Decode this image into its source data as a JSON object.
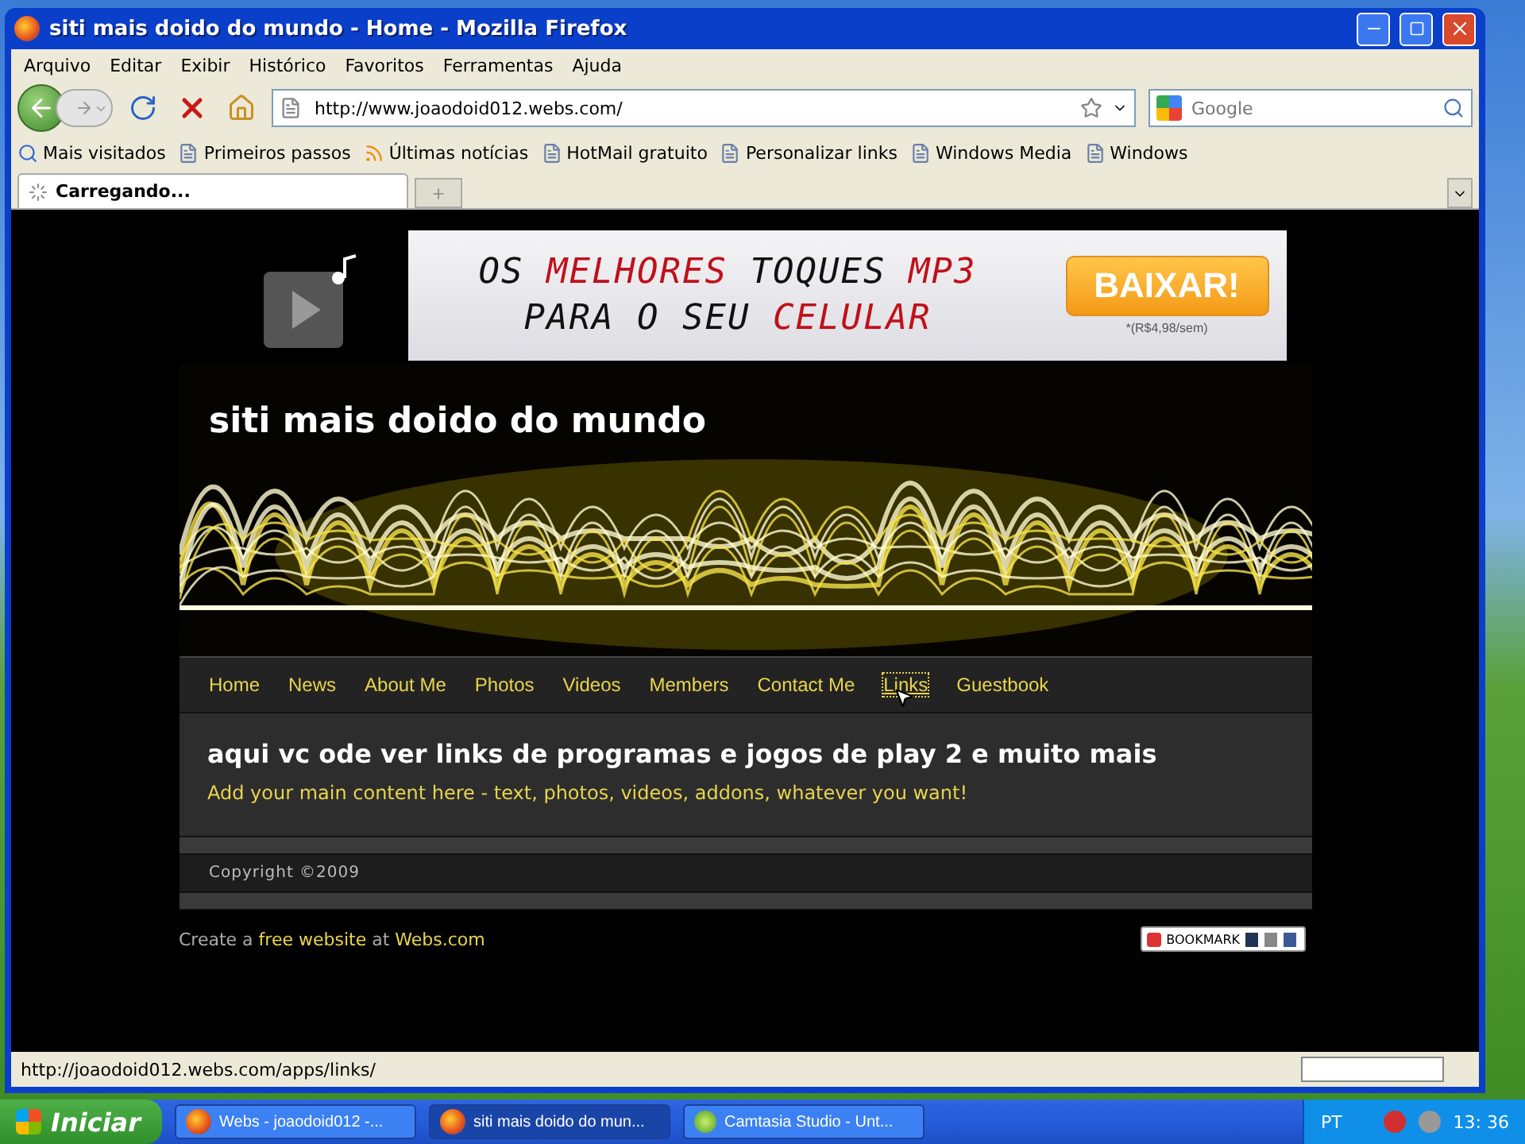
{
  "window": {
    "title": "siti mais doido do mundo - Home - Mozilla Firefox"
  },
  "menu": [
    "Arquivo",
    "Editar",
    "Exibir",
    "Histórico",
    "Favoritos",
    "Ferramentas",
    "Ajuda"
  ],
  "address": {
    "value": "http://www.joaodoid012.webs.com/"
  },
  "search": {
    "placeholder": "Google"
  },
  "bookmarks": [
    {
      "label": "Mais visitados",
      "kind": "folder"
    },
    {
      "label": "Primeiros passos",
      "kind": "page"
    },
    {
      "label": "Últimas notícias",
      "kind": "feed"
    },
    {
      "label": "HotMail gratuito",
      "kind": "page"
    },
    {
      "label": "Personalizar links",
      "kind": "page"
    },
    {
      "label": "Windows Media",
      "kind": "page"
    },
    {
      "label": "Windows",
      "kind": "page"
    }
  ],
  "tabs": [
    {
      "label": "Carregando...",
      "selected": true
    }
  ],
  "ad": {
    "line_1": [
      {
        "text": "OS ",
        "color": "#111111"
      },
      {
        "text": "MELHORES ",
        "color": "#c0101a"
      },
      {
        "text": "TOQUES ",
        "color": "#111111"
      },
      {
        "text": "MP3",
        "color": "#c0101a"
      }
    ],
    "line_2": [
      {
        "text": "PARA O SEU ",
        "color": "#111111"
      },
      {
        "text": "CELULAR",
        "color": "#c0101a"
      }
    ],
    "button": "BAIXAR!",
    "price": "*(R$4,98/sem)"
  },
  "site": {
    "title": "siti mais doido do mundo",
    "nav": [
      {
        "label": "Home",
        "selected": false
      },
      {
        "label": "News",
        "selected": false
      },
      {
        "label": "About Me",
        "selected": false
      },
      {
        "label": "Photos",
        "selected": false
      },
      {
        "label": "Videos",
        "selected": false
      },
      {
        "label": "Members",
        "selected": false
      },
      {
        "label": "Contact Me",
        "selected": false
      },
      {
        "label": "Links",
        "selected": true
      },
      {
        "label": "Guestbook",
        "selected": false
      }
    ],
    "heading": "aqui vc ode ver links de programas e jogos de play 2 e muito mais",
    "body": "Add your main content here - text, photos, videos, addons, whatever you want!",
    "copyright": "Copyright ©2009",
    "footer": [
      {
        "text": "Create a ",
        "link": false
      },
      {
        "text": "free website",
        "link": true
      },
      {
        "text": " at ",
        "link": false
      },
      {
        "text": "Webs.com",
        "link": true
      }
    ],
    "bookmark_button": "BOOKMARK"
  },
  "status_bar": {
    "text": "http://joaodoid012.webs.com/apps/links/"
  },
  "taskbar": {
    "start": "Iniciar",
    "tasks": [
      {
        "label": "Webs - joaodoid012 -...",
        "kind": "firefox",
        "selected": false
      },
      {
        "label": "siti mais doido do mun...",
        "kind": "firefox",
        "selected": true
      },
      {
        "label": "Camtasia Studio - Unt...",
        "kind": "camtasia",
        "selected": false
      }
    ],
    "language": "PT",
    "clock": "13: 36"
  }
}
